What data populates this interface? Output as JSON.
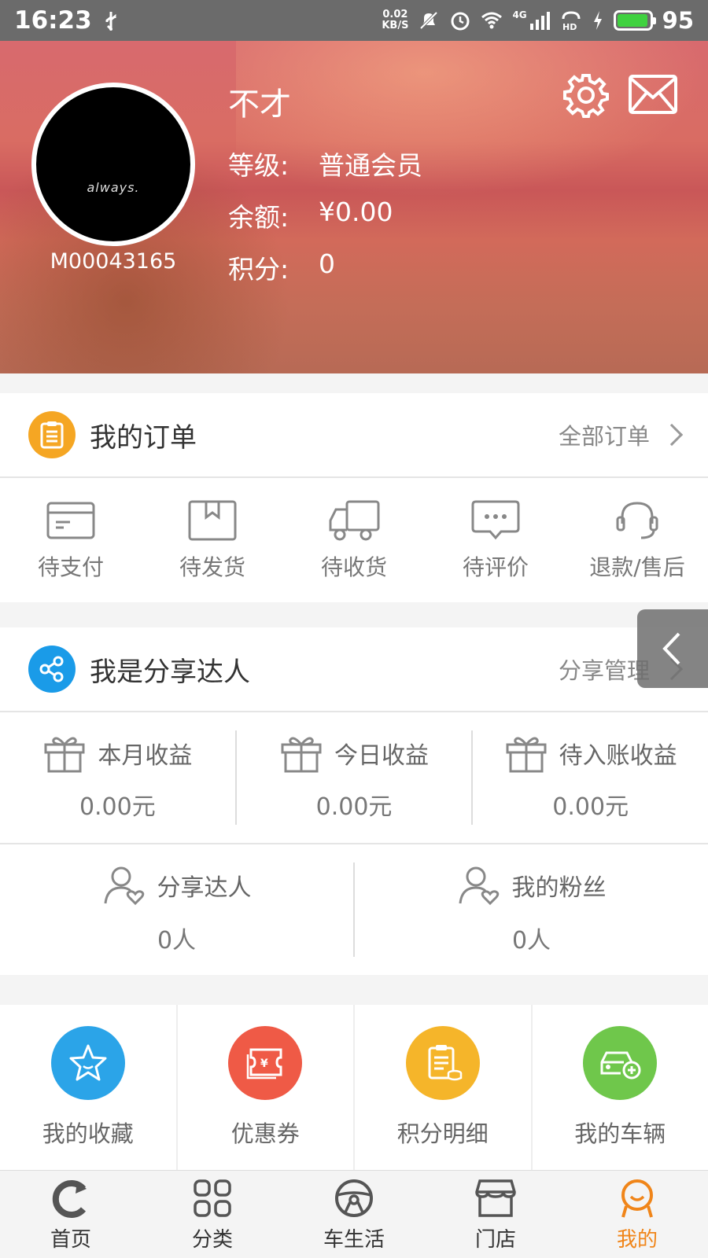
{
  "status_bar": {
    "time": "16:23",
    "net_speed_value": "0.02",
    "net_speed_unit": "KB/S",
    "network": "4G",
    "hd": "HD",
    "battery": "95",
    "battery_color": "#3fd13f"
  },
  "profile": {
    "avatar_text": "always.",
    "member_id": "M00043165",
    "username": "不才",
    "level_label": "等级:",
    "level_value": "普通会员",
    "balance_label": "余额:",
    "balance_value": "¥0.00",
    "points_label": "积分:",
    "points_value": "0"
  },
  "orders": {
    "title": "我的订单",
    "link": "全部订单",
    "icon_color": "#f5a623",
    "items": [
      {
        "label": "待支付",
        "icon": "card-icon"
      },
      {
        "label": "待发货",
        "icon": "box-icon"
      },
      {
        "label": "待收货",
        "icon": "truck-icon"
      },
      {
        "label": "待评价",
        "icon": "comment-icon"
      },
      {
        "label": "退款/售后",
        "icon": "headset-icon"
      }
    ]
  },
  "share": {
    "title": "我是分享达人",
    "link": "分享管理",
    "icon_color": "#1a9be8",
    "earnings": [
      {
        "label": "本月收益",
        "value": "0.00元"
      },
      {
        "label": "今日收益",
        "value": "0.00元"
      },
      {
        "label": "待入账收益",
        "value": "0.00元"
      }
    ],
    "fans": [
      {
        "label": "分享达人",
        "value": "0人"
      },
      {
        "label": "我的粉丝",
        "value": "0人"
      }
    ]
  },
  "tools": [
    {
      "label": "我的收藏",
      "icon": "star-icon",
      "color": "#2ba4e8"
    },
    {
      "label": "优惠券",
      "icon": "coupon-icon",
      "color": "#ef5a46"
    },
    {
      "label": "积分明细",
      "icon": "points-list-icon",
      "color": "#f5b52a"
    },
    {
      "label": "我的车辆",
      "icon": "car-add-icon",
      "color": "#6fc74b"
    }
  ],
  "nav": {
    "accent": "#f08519",
    "items": [
      {
        "label": "首页",
        "icon": "home-refresh-icon"
      },
      {
        "label": "分类",
        "icon": "grid-icon"
      },
      {
        "label": "车生活",
        "icon": "steering-wheel-icon"
      },
      {
        "label": "门店",
        "icon": "store-icon"
      },
      {
        "label": "我的",
        "icon": "user-icon",
        "active": true
      }
    ]
  }
}
